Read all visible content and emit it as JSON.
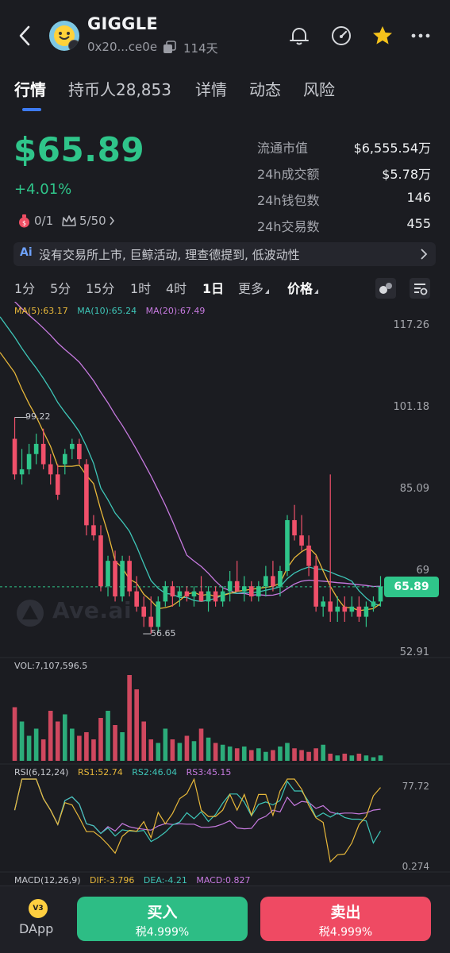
{
  "header": {
    "token_name": "GIGGLE",
    "address": "0x20...ce0e",
    "age": "114天",
    "icons": [
      "back-icon",
      "bell-icon",
      "gauge-icon",
      "star-icon",
      "more-icon"
    ]
  },
  "tabs": [
    {
      "label": "行情",
      "active": true
    },
    {
      "label": "持币人28,853",
      "active": false
    },
    {
      "label": "详情",
      "active": false
    },
    {
      "label": "动态",
      "active": false
    },
    {
      "label": "风险",
      "active": false
    }
  ],
  "price": {
    "value": "$65.89",
    "change": "+4.01%",
    "chip1": "0/1",
    "chip2": "5/50"
  },
  "stats": [
    {
      "label": "流通市值",
      "value": "$6,555.54万"
    },
    {
      "label": "24h成交额",
      "value": "$5.78万"
    },
    {
      "label": "24h钱包数",
      "value": "146"
    },
    {
      "label": "24h交易数",
      "value": "455"
    }
  ],
  "ai_banner": {
    "badge": "Ai",
    "text": "没有交易所上市, 巨鲸活动, 理查德提到, 低波动性"
  },
  "intervals": [
    {
      "label": "1分",
      "active": false
    },
    {
      "label": "5分",
      "active": false
    },
    {
      "label": "15分",
      "active": false
    },
    {
      "label": "1时",
      "active": false
    },
    {
      "label": "4时",
      "active": false
    },
    {
      "label": "1日",
      "active": true
    },
    {
      "label": "更多",
      "active": false,
      "caret": true
    },
    {
      "label": "价格",
      "active": false,
      "caret": true
    }
  ],
  "colors": {
    "up": "#2fc58a",
    "down": "#f0506a",
    "ma5": "#e8b83a",
    "ma10": "#3ec6b8",
    "ma20": "#c77ae0",
    "accent": "#3d7bf2"
  },
  "chart_data": {
    "type": "candlestick",
    "price_axis": [
      "117.26",
      "101.18",
      "85.09",
      "69",
      "52.91"
    ],
    "last_price": "65.89",
    "high_label": "99.22",
    "low_label": "56.65",
    "ma_legend": {
      "ma5": "MA(5):63.17",
      "ma10": "MA(10):65.24",
      "ma20": "MA(20):67.49"
    },
    "candles": [
      [
        95,
        99.22,
        87,
        88
      ],
      [
        88,
        93,
        86,
        89
      ],
      [
        89,
        94,
        88,
        92
      ],
      [
        92,
        96,
        90,
        94
      ],
      [
        94,
        97,
        89,
        90
      ],
      [
        90,
        92,
        86,
        88
      ],
      [
        88,
        90,
        83,
        84
      ],
      [
        90,
        93,
        88,
        92
      ],
      [
        93,
        95,
        91,
        94
      ],
      [
        94,
        95,
        90,
        91
      ],
      [
        90,
        91,
        76,
        78
      ],
      [
        78,
        80,
        75,
        76
      ],
      [
        76,
        78,
        65,
        66
      ],
      [
        66,
        72,
        64,
        71
      ],
      [
        71,
        73,
        63,
        64
      ],
      [
        64,
        72,
        63,
        71
      ],
      [
        71,
        72,
        64,
        65
      ],
      [
        65,
        68,
        61,
        62
      ],
      [
        62,
        64,
        58,
        60
      ],
      [
        60,
        64,
        56.65,
        58
      ],
      [
        58,
        64,
        57,
        63
      ],
      [
        63,
        67,
        62,
        66
      ],
      [
        66,
        67,
        62,
        64
      ],
      [
        64,
        66,
        62,
        65
      ],
      [
        65,
        66,
        63,
        64
      ],
      [
        64,
        66,
        62,
        65
      ],
      [
        65,
        68,
        63,
        63
      ],
      [
        63,
        66,
        61,
        65
      ],
      [
        65,
        66,
        62,
        63
      ],
      [
        63,
        66,
        62,
        65
      ],
      [
        65,
        69,
        63,
        67
      ],
      [
        67,
        71,
        65,
        65
      ],
      [
        65,
        68,
        63,
        66
      ],
      [
        66,
        67,
        63,
        64
      ],
      [
        64,
        67,
        63,
        66
      ],
      [
        66,
        70,
        64,
        68
      ],
      [
        68,
        71,
        65,
        66
      ],
      [
        66,
        70,
        64,
        69
      ],
      [
        69,
        80,
        68,
        79
      ],
      [
        79,
        82,
        75,
        76
      ],
      [
        76,
        80,
        73,
        74
      ],
      [
        74,
        76,
        68,
        70
      ],
      [
        70,
        72,
        61,
        62
      ],
      [
        62,
        64,
        60,
        63
      ],
      [
        63,
        88,
        59,
        61
      ],
      [
        61,
        64,
        59,
        62
      ],
      [
        62,
        64,
        59,
        61
      ],
      [
        61,
        64,
        60,
        62
      ],
      [
        62,
        64,
        59,
        60
      ],
      [
        60,
        63,
        58,
        62
      ],
      [
        62,
        64,
        61,
        63
      ],
      [
        63,
        68,
        62,
        65.89
      ]
    ],
    "volume": {
      "label": "VOL:7,107,596.5",
      "values": [
        30,
        22,
        14,
        18,
        12,
        28,
        22,
        26,
        18,
        14,
        16,
        12,
        24,
        28,
        20,
        16,
        48,
        40,
        22,
        12,
        10,
        18,
        12,
        10,
        14,
        11,
        18,
        13,
        10,
        9,
        8,
        7,
        8,
        6,
        7,
        5,
        6,
        8,
        10,
        7,
        6,
        5,
        7,
        9,
        4,
        3,
        4,
        3,
        4,
        3,
        2,
        3
      ]
    },
    "rsi": {
      "label": "RSI(6,12,24)",
      "rs1": "RS1:52.74",
      "rs2": "RS2:46.04",
      "rs3": "RS3:45.15",
      "top": "77.72",
      "bottom": "0.274"
    },
    "macd": {
      "label": "MACD(12,26,9)",
      "dif": "DIF:-3.796",
      "dea": "DEA:-4.21",
      "macd": "MACD:0.827"
    },
    "watermark": "Ave.ai"
  },
  "bottom": {
    "dapp_badge": "V3",
    "dapp_label": "DApp",
    "buy_label": "买入",
    "buy_tax": "税4.999%",
    "sell_label": "卖出",
    "sell_tax": "税4.999%"
  }
}
